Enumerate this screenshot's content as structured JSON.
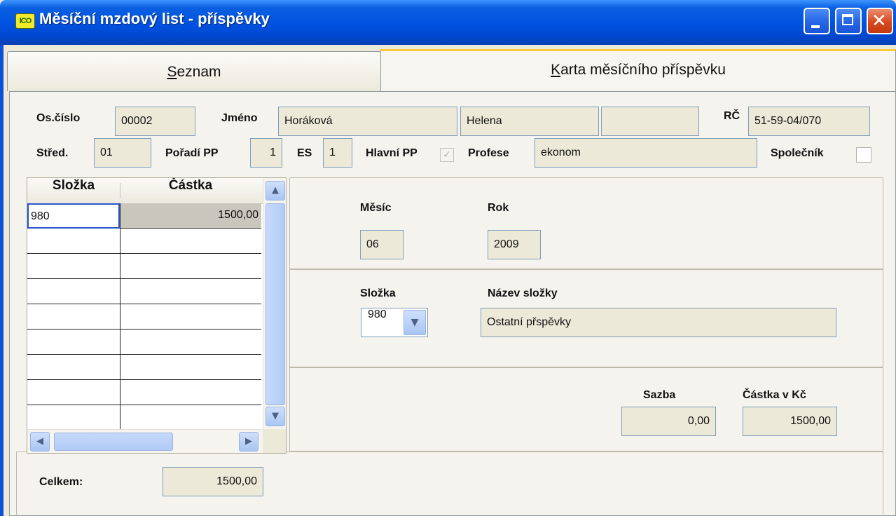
{
  "window": {
    "title": "Měsíční mzdový list - příspěvky",
    "app_icon_text": "ICO"
  },
  "tabs": [
    {
      "label": "Seznam",
      "underline_index": 0
    },
    {
      "label": "Karta měsíčního příspěvku",
      "underline_index": 0
    }
  ],
  "header": {
    "os_cislo_label": "Os.číslo",
    "os_cislo": "00002",
    "jmeno_label": "Jméno",
    "prijmeni": "Horáková",
    "jmeno": "Helena",
    "titul": "",
    "rc_label": "RČ",
    "rc": "51-59-04/070",
    "stred_label": "Střed.",
    "stred": "01",
    "poradi_label": "Pořadí PP",
    "poradi": "1",
    "es_label": "ES",
    "es": "1",
    "hlavni_label": "Hlavní PP",
    "hlavni_checked": true,
    "profese_label": "Profese",
    "profese": "ekonom",
    "spolecnik_label": "Společník",
    "spolecnik_checked": false
  },
  "grid": {
    "columns": [
      "Složka",
      "Částka"
    ],
    "rows": [
      {
        "slozka": "980",
        "castka": "1500,00"
      }
    ]
  },
  "detail": {
    "mesic_label": "Měsíc",
    "mesic": "06",
    "rok_label": "Rok",
    "rok": "2009",
    "slozka_label": "Složka",
    "slozka": "980",
    "nazev_label": "Název složky",
    "nazev": "Ostatní přspěvky",
    "sazba_label": "Sazba",
    "sazba": "0,00",
    "castka_label": "Částka v Kč",
    "castka": "1500,00"
  },
  "footer": {
    "celkem_label": "Celkem:",
    "celkem": "1500,00"
  }
}
